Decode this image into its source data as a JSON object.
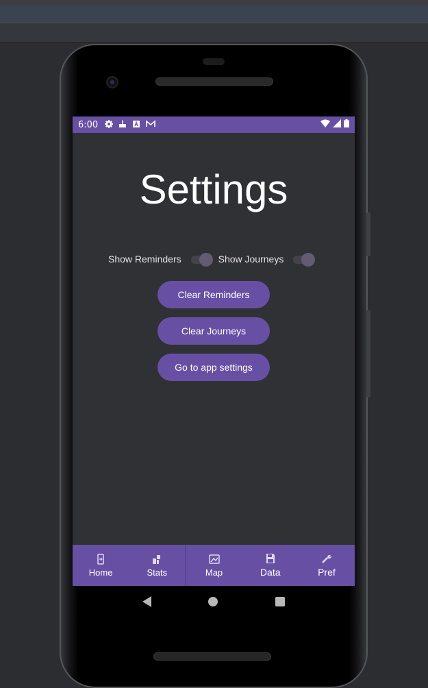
{
  "status_bar": {
    "time": "6:00",
    "icons_left": [
      "gear-icon",
      "cake-icon",
      "a-icon",
      "gmail-icon"
    ],
    "icons_right": [
      "wifi-icon",
      "signal-icon",
      "battery-icon"
    ]
  },
  "page": {
    "title": "Settings"
  },
  "toggles": [
    {
      "label": "Show Reminders",
      "on": true
    },
    {
      "label": "Show Journeys",
      "on": true
    }
  ],
  "buttons": {
    "clear_reminders": "Clear Reminders",
    "clear_journeys": "Clear Journeys",
    "app_settings": "Go to app settings"
  },
  "bottom_nav": [
    {
      "label": "Home",
      "icon": "phone-icon"
    },
    {
      "label": "Stats",
      "icon": "stats-icon"
    },
    {
      "label": "Map",
      "icon": "map-icon"
    },
    {
      "label": "Data",
      "icon": "save-icon"
    },
    {
      "label": "Pref",
      "icon": "wrench-icon"
    }
  ],
  "colors": {
    "primary": "#6750a4",
    "background": "#2f3134",
    "text": "#ffffff"
  }
}
